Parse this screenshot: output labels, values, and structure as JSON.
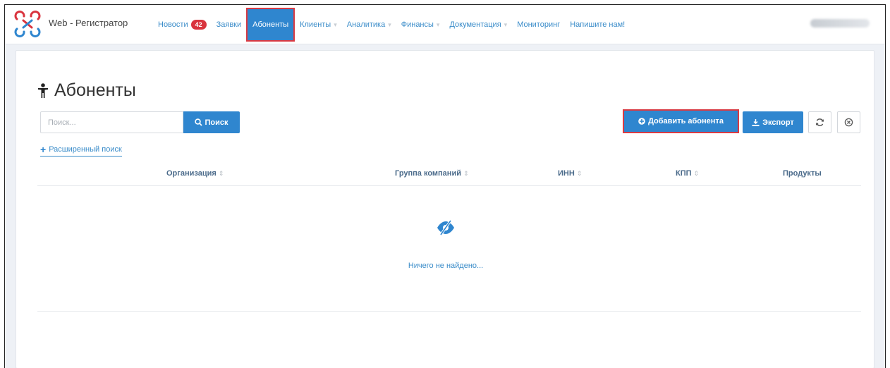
{
  "app": {
    "brand": "Web - Регистратор"
  },
  "nav": {
    "items": [
      {
        "label": "Новости",
        "badge": "42",
        "caret": false,
        "active": false
      },
      {
        "label": "Заявки",
        "caret": false,
        "active": false
      },
      {
        "label": "Абоненты",
        "caret": false,
        "active": true
      },
      {
        "label": "Клиенты",
        "caret": true,
        "active": false
      },
      {
        "label": "Аналитика",
        "caret": true,
        "active": false
      },
      {
        "label": "Финансы",
        "caret": true,
        "active": false
      },
      {
        "label": "Документация",
        "caret": true,
        "active": false
      },
      {
        "label": "Мониторинг",
        "caret": false,
        "active": false
      },
      {
        "label": "Напишите нам!",
        "caret": false,
        "active": false
      }
    ]
  },
  "page": {
    "title": "Абоненты"
  },
  "search": {
    "placeholder": "Поиск...",
    "button": "Поиск",
    "advanced": "Расширенный поиск"
  },
  "actions": {
    "add": "Добавить абонента",
    "export": "Экспорт"
  },
  "table": {
    "columns": [
      "Организация",
      "Группа компаний",
      "ИНН",
      "КПП",
      "Продукты"
    ],
    "empty": "Ничего не найдено..."
  },
  "colors": {
    "accent": "#2f86cf",
    "highlight": "#d93a43",
    "badge": "#d9343e"
  }
}
